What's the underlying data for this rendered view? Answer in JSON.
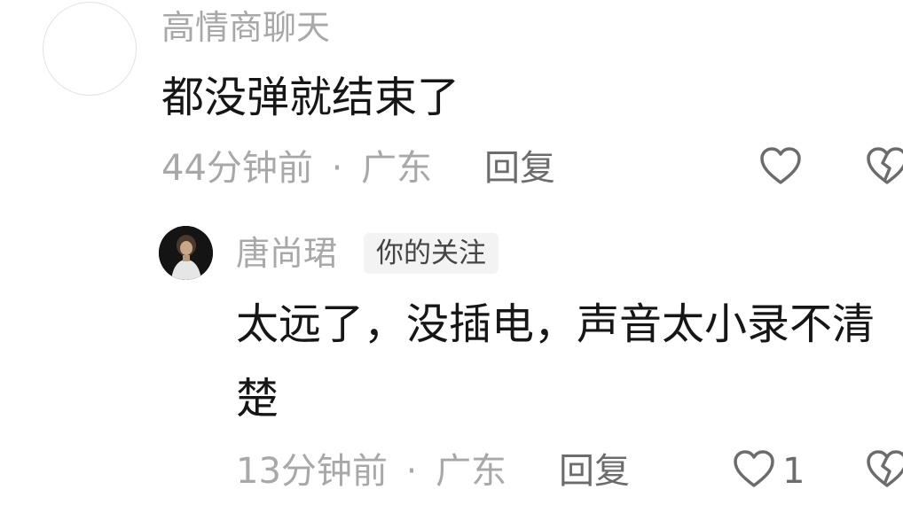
{
  "comments": [
    {
      "username": "高情商聊天",
      "text": "都没弹就结束了",
      "time": "44分钟前",
      "separator": "·",
      "location": "广东",
      "reply_label": "回复",
      "like_icon": "heart-outline-icon",
      "dislike_icon": "broken-heart-icon"
    },
    {
      "username": "唐尚珺",
      "badge": "你的关注",
      "text_line1": "太远了，没插电，声音太小录不清",
      "text_line2": "楚",
      "time": "13分钟前",
      "separator": "·",
      "location": "广东",
      "reply_label": "回复",
      "like_count": "1",
      "like_icon": "heart-outline-icon",
      "dislike_icon": "broken-heart-icon"
    }
  ],
  "colors": {
    "username": "#a8a8a8",
    "text": "#161616",
    "meta": "#a8a8a8",
    "action": "#6c6c6c",
    "badge_bg": "#f3f3f3"
  }
}
